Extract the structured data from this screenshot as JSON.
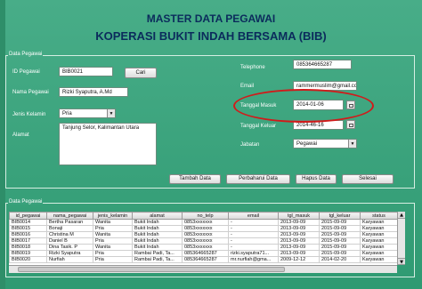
{
  "header": {
    "title_line1": "MASTER DATA PEGAWAI",
    "title_line2": "KOPERASI BUKIT INDAH BERSAMA (BIB)"
  },
  "form": {
    "legend": "Data Pegawai",
    "id_label": "ID Pegawai",
    "id_value": "BIB0021",
    "search_button": "Cari",
    "nama_label": "Nama Pegawai",
    "nama_value": "Rizki Syaputra, A.Md",
    "jk_label": "Jenis Kelamin",
    "jk_value": "Pria",
    "alamat_label": "Alamat",
    "alamat_value": "Tanjung Selor, Kalimantan Utara",
    "telp_label": "Telephone",
    "telp_value": "085364665287",
    "email_label": "Email",
    "email_value": "rammermuslim@gmail.com",
    "tgl_masuk_label": "Tanggal Masuk",
    "tgl_masuk_value": "2014-01-06",
    "tgl_keluar_label": "Tanggal Keluar",
    "tgl_keluar_value": "2014-46-16",
    "jabatan_label": "Jabatan",
    "jabatan_value": "Pegawai"
  },
  "actions": {
    "tambah": "Tambah Data",
    "perbaharui": "Perbaharui Data",
    "hapus": "Hapus Data",
    "selesai": "Selesai"
  },
  "table": {
    "legend": "Data Pegawai",
    "columns": [
      "id_pegawai",
      "nama_pegawai",
      "jenis_kelamin",
      "alamat",
      "no_telp",
      "email",
      "tgl_masuk",
      "tgl_keluar",
      "status"
    ],
    "rows": [
      [
        "BIB0014",
        "Bertha Pasaran",
        "Wanita",
        "Bukit Indah",
        "0853xxxxxxx",
        "-",
        "2013-09-09",
        "2015-09-09",
        "Karyawan"
      ],
      [
        "BIB0015",
        "Bonaji",
        "Pria",
        "Bukit Indah",
        "0853xxxxxxx",
        "-",
        "2013-09-09",
        "2015-09-09",
        "Karyawan"
      ],
      [
        "BIB0016",
        "Christina M",
        "Wanita",
        "Bukit Indah",
        "0853xxxxxxx",
        "-",
        "2013-09-09",
        "2015-09-09",
        "Karyawan"
      ],
      [
        "BIB0017",
        "Daniel B",
        "Pria",
        "Bukit Indah",
        "0853xxxxxxx",
        "-",
        "2013-09-09",
        "2015-09-09",
        "Karyawan"
      ],
      [
        "BIB0018",
        "Dina Tasik. P",
        "Wanita",
        "Bukit Indah",
        "0853xxxxxxx",
        "-",
        "2013-09-09",
        "2015-09-09",
        "Karyawan"
      ],
      [
        "BIB0019",
        "Rizki Syaputra",
        "Pria",
        "Rambai Padi, Ta...",
        "085364665287",
        "rizki.syaputra71...",
        "2013-09-09",
        "2015-09-09",
        "Karyawan"
      ],
      [
        "BIB0020",
        "Nurfiah",
        "Pria",
        "Rambai Padi, Ta...",
        "085364665287",
        "mr.nurfiah@gma...",
        "2009-12-12",
        "2014-02-20",
        "Karyawan"
      ]
    ]
  }
}
